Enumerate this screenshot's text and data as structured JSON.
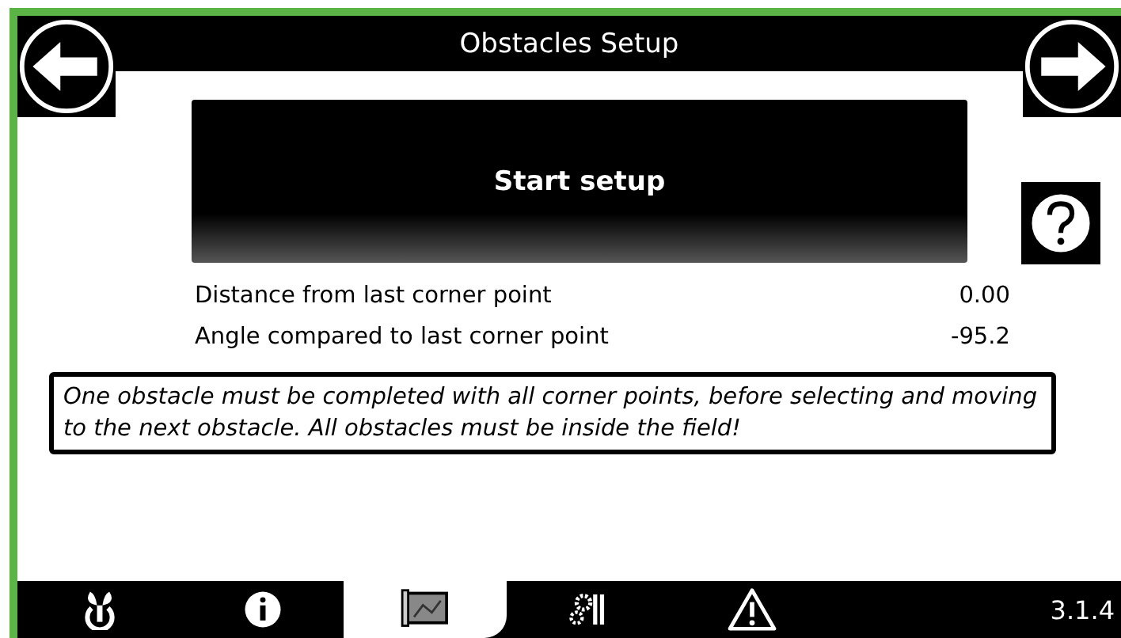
{
  "window": {
    "title": "Obstacles Setup"
  },
  "start_button": {
    "label": "Start setup"
  },
  "readings": [
    {
      "label": "Distance from last corner point",
      "value": "0.00"
    },
    {
      "label": "Angle compared to last corner point",
      "value": "-95.2"
    }
  ],
  "notice": "One obstacle must be completed with all corner points, before selecting and moving to the next obstacle. All obstacles must be inside the field!",
  "tabs": [
    {
      "kind": "power",
      "selected": false
    },
    {
      "kind": "info",
      "selected": false
    },
    {
      "kind": "map",
      "selected": true
    },
    {
      "kind": "tools",
      "selected": false
    },
    {
      "kind": "warning",
      "selected": false
    }
  ],
  "version": "3.1.4"
}
